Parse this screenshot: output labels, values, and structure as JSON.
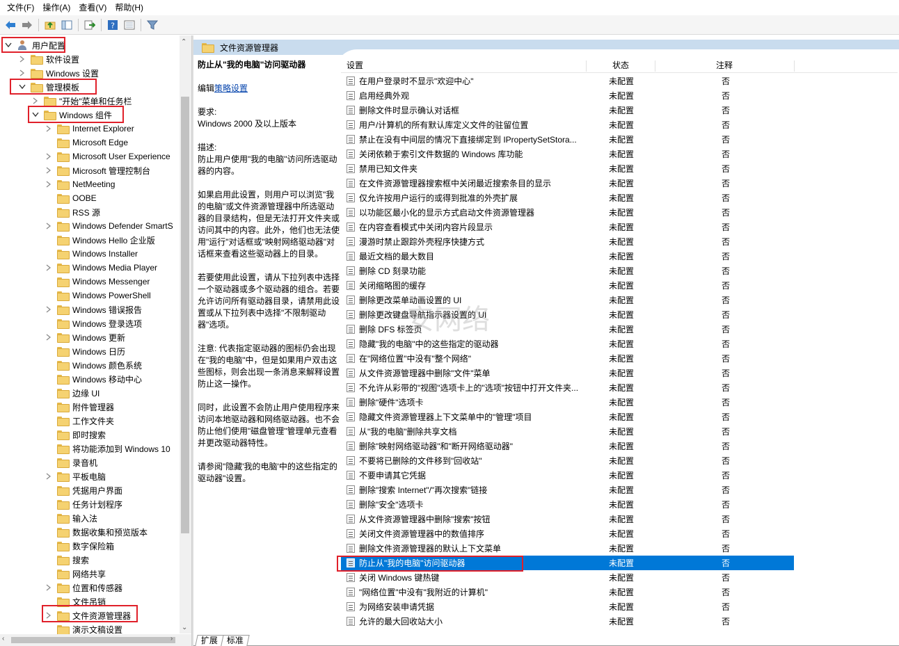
{
  "menu": [
    "文件(F)",
    "操作(A)",
    "查看(V)",
    "帮助(H)"
  ],
  "toolbar_icons": [
    "back-icon",
    "forward-icon",
    "up-folder-icon",
    "show-hide-tree-icon",
    "export-list-icon",
    "help-icon",
    "properties-icon",
    "filter-icon"
  ],
  "tree": {
    "items": [
      {
        "label": "用户配置",
        "level": 0,
        "expander": "expanded",
        "icon": "user-icon"
      },
      {
        "label": "软件设置",
        "level": 1,
        "expander": "collapsed",
        "icon": "folder-icon"
      },
      {
        "label": "Windows 设置",
        "level": 1,
        "expander": "collapsed",
        "icon": "folder-icon"
      },
      {
        "label": "管理模板",
        "level": 1,
        "expander": "expanded",
        "icon": "folder-icon"
      },
      {
        "label": "\"开始\"菜单和任务栏",
        "level": 2,
        "expander": "collapsed",
        "icon": "folder-icon"
      },
      {
        "label": "Windows 组件",
        "level": 2,
        "expander": "expanded",
        "icon": "folder-icon"
      },
      {
        "label": "Internet Explorer",
        "level": 3,
        "expander": "collapsed",
        "icon": "folder-icon"
      },
      {
        "label": "Microsoft Edge",
        "level": 3,
        "expander": "none",
        "icon": "folder-icon"
      },
      {
        "label": "Microsoft User Experience",
        "level": 3,
        "expander": "collapsed",
        "icon": "folder-icon"
      },
      {
        "label": "Microsoft 管理控制台",
        "level": 3,
        "expander": "collapsed",
        "icon": "folder-icon"
      },
      {
        "label": "NetMeeting",
        "level": 3,
        "expander": "collapsed",
        "icon": "folder-icon"
      },
      {
        "label": "OOBE",
        "level": 3,
        "expander": "none",
        "icon": "folder-icon"
      },
      {
        "label": "RSS 源",
        "level": 3,
        "expander": "none",
        "icon": "folder-icon"
      },
      {
        "label": "Windows Defender SmartS",
        "level": 3,
        "expander": "collapsed",
        "icon": "folder-icon"
      },
      {
        "label": "Windows Hello 企业版",
        "level": 3,
        "expander": "none",
        "icon": "folder-icon"
      },
      {
        "label": "Windows Installer",
        "level": 3,
        "expander": "none",
        "icon": "folder-icon"
      },
      {
        "label": "Windows Media Player",
        "level": 3,
        "expander": "collapsed",
        "icon": "folder-icon"
      },
      {
        "label": "Windows Messenger",
        "level": 3,
        "expander": "none",
        "icon": "folder-icon"
      },
      {
        "label": "Windows PowerShell",
        "level": 3,
        "expander": "none",
        "icon": "folder-icon"
      },
      {
        "label": "Windows 错误报告",
        "level": 3,
        "expander": "collapsed",
        "icon": "folder-icon"
      },
      {
        "label": "Windows 登录选项",
        "level": 3,
        "expander": "none",
        "icon": "folder-icon"
      },
      {
        "label": "Windows 更新",
        "level": 3,
        "expander": "collapsed",
        "icon": "folder-icon"
      },
      {
        "label": "Windows 日历",
        "level": 3,
        "expander": "none",
        "icon": "folder-icon"
      },
      {
        "label": "Windows 颜色系统",
        "level": 3,
        "expander": "none",
        "icon": "folder-icon"
      },
      {
        "label": "Windows 移动中心",
        "level": 3,
        "expander": "none",
        "icon": "folder-icon"
      },
      {
        "label": "边缘 UI",
        "level": 3,
        "expander": "none",
        "icon": "folder-icon"
      },
      {
        "label": "附件管理器",
        "level": 3,
        "expander": "none",
        "icon": "folder-icon"
      },
      {
        "label": "工作文件夹",
        "level": 3,
        "expander": "none",
        "icon": "folder-icon"
      },
      {
        "label": "即时搜索",
        "level": 3,
        "expander": "none",
        "icon": "folder-icon"
      },
      {
        "label": "将功能添加到 Windows 10",
        "level": 3,
        "expander": "none",
        "icon": "folder-icon"
      },
      {
        "label": "录音机",
        "level": 3,
        "expander": "none",
        "icon": "folder-icon"
      },
      {
        "label": "平板电脑",
        "level": 3,
        "expander": "collapsed",
        "icon": "folder-icon"
      },
      {
        "label": "凭据用户界面",
        "level": 3,
        "expander": "none",
        "icon": "folder-icon"
      },
      {
        "label": "任务计划程序",
        "level": 3,
        "expander": "none",
        "icon": "folder-icon"
      },
      {
        "label": "输入法",
        "level": 3,
        "expander": "none",
        "icon": "folder-icon"
      },
      {
        "label": "数据收集和预览版本",
        "level": 3,
        "expander": "none",
        "icon": "folder-icon"
      },
      {
        "label": "数字保险箱",
        "level": 3,
        "expander": "none",
        "icon": "folder-icon"
      },
      {
        "label": "搜索",
        "level": 3,
        "expander": "none",
        "icon": "folder-icon"
      },
      {
        "label": "网络共享",
        "level": 3,
        "expander": "none",
        "icon": "folder-icon"
      },
      {
        "label": "位置和传感器",
        "level": 3,
        "expander": "collapsed",
        "icon": "folder-icon"
      },
      {
        "label": "文件吊销",
        "level": 3,
        "expander": "none",
        "icon": "folder-icon"
      },
      {
        "label": "文件资源管理器",
        "level": 3,
        "expander": "collapsed",
        "icon": "folder-icon"
      },
      {
        "label": "演示文稿设置",
        "level": 3,
        "expander": "none",
        "icon": "folder-icon"
      }
    ]
  },
  "right": {
    "header_title": "文件资源管理器",
    "description": {
      "title": "防止从\"我的电脑\"访问驱动器",
      "edit_prefix": "编辑",
      "edit_link": "策略设置",
      "req_label": "要求:",
      "req_value": "Windows 2000 及以上版本",
      "desc_label": "描述:",
      "desc_text": "防止用户使用\"我的电脑\"访问所选驱动器的内容。",
      "para1": "如果启用此设置，则用户可以浏览\"我的电脑\"或文件资源管理器中所选驱动器的目录结构，但是无法打开文件夹或访问其中的内容。此外，他们也无法使用\"运行\"对话框或\"映射网络驱动器\"对话框来查看这些驱动器上的目录。",
      "para2": "若要使用此设置，请从下拉列表中选择一个驱动器或多个驱动器的组合。若要允许访问所有驱动器目录，请禁用此设置或从下拉列表中选择\"不限制驱动器\"选项。",
      "para3": "注意: 代表指定驱动器的图标仍会出现在\"我的电脑\"中，但是如果用户双击这些图标，则会出现一条消息来解释设置防止这一操作。",
      "para4": " 同时，此设置不会防止用户使用程序来访问本地驱动器和网络驱动器。也不会防止他们使用\"磁盘管理\"管理单元查看并更改驱动器特性。",
      "para5": "请参阅\"隐藏'我的电脑'中的这些指定的驱动器\"设置。"
    },
    "columns": {
      "setting": "设置",
      "state": "状态",
      "note": "注释"
    },
    "rows": [
      {
        "name": "在用户登录时不显示\"欢迎中心\"",
        "state": "未配置",
        "note": "否"
      },
      {
        "name": "启用经典外观",
        "state": "未配置",
        "note": "否"
      },
      {
        "name": "删除文件时显示确认对话框",
        "state": "未配置",
        "note": "否"
      },
      {
        "name": "用户/计算机的所有默认库定义文件的驻留位置",
        "state": "未配置",
        "note": "否"
      },
      {
        "name": "禁止在没有中间层的情况下直接绑定到 IPropertySetStora...",
        "state": "未配置",
        "note": "否"
      },
      {
        "name": "关闭依赖于索引文件数据的 Windows 库功能",
        "state": "未配置",
        "note": "否"
      },
      {
        "name": "禁用已知文件夹",
        "state": "未配置",
        "note": "否"
      },
      {
        "name": "在文件资源管理器搜索框中关闭最近搜索条目的显示",
        "state": "未配置",
        "note": "否"
      },
      {
        "name": "仅允许按用户运行的或得到批准的外壳扩展",
        "state": "未配置",
        "note": "否"
      },
      {
        "name": "以功能区最小化的显示方式启动文件资源管理器",
        "state": "未配置",
        "note": "否"
      },
      {
        "name": "在内容查看模式中关闭内容片段显示",
        "state": "未配置",
        "note": "否"
      },
      {
        "name": "漫游时禁止跟踪外壳程序快捷方式",
        "state": "未配置",
        "note": "否"
      },
      {
        "name": "最近文档的最大数目",
        "state": "未配置",
        "note": "否"
      },
      {
        "name": "删除 CD 刻录功能",
        "state": "未配置",
        "note": "否"
      },
      {
        "name": "关闭缩略图的缓存",
        "state": "未配置",
        "note": "否"
      },
      {
        "name": "删除更改菜单动画设置的 UI",
        "state": "未配置",
        "note": "否"
      },
      {
        "name": "删除更改键盘导航指示器设置的 UI",
        "state": "未配置",
        "note": "否"
      },
      {
        "name": "删除 DFS 标签页",
        "state": "未配置",
        "note": "否"
      },
      {
        "name": "隐藏\"我的电脑\"中的这些指定的驱动器",
        "state": "未配置",
        "note": "否"
      },
      {
        "name": "在\"网络位置\"中没有\"整个网络\"",
        "state": "未配置",
        "note": "否"
      },
      {
        "name": "从文件资源管理器中删除\"文件\"菜单",
        "state": "未配置",
        "note": "否"
      },
      {
        "name": "不允许从彩带的\"视图\"选项卡上的\"选项\"按钮中打开文件夹...",
        "state": "未配置",
        "note": "否"
      },
      {
        "name": "删除\"硬件\"选项卡",
        "state": "未配置",
        "note": "否"
      },
      {
        "name": "隐藏文件资源管理器上下文菜单中的\"管理\"项目",
        "state": "未配置",
        "note": "否"
      },
      {
        "name": "从\"我的电脑\"删除共享文档",
        "state": "未配置",
        "note": "否"
      },
      {
        "name": "删除\"映射网络驱动器\"和\"断开网络驱动器\"",
        "state": "未配置",
        "note": "否"
      },
      {
        "name": "不要将已删除的文件移到\"回收站\"",
        "state": "未配置",
        "note": "否"
      },
      {
        "name": "不要申请其它凭据",
        "state": "未配置",
        "note": "否"
      },
      {
        "name": "删除\"搜索 Internet\"/\"再次搜索\"链接",
        "state": "未配置",
        "note": "否"
      },
      {
        "name": "删除\"安全\"选项卡",
        "state": "未配置",
        "note": "否"
      },
      {
        "name": "从文件资源管理器中删除\"搜索\"按钮",
        "state": "未配置",
        "note": "否"
      },
      {
        "name": "关闭文件资源管理器中的数值排序",
        "state": "未配置",
        "note": "否"
      },
      {
        "name": "删除文件资源管理器的默认上下文菜单",
        "state": "未配置",
        "note": "否"
      },
      {
        "name": "防止从\"我的电脑\"访问驱动器",
        "state": "未配置",
        "note": "否",
        "selected": true
      },
      {
        "name": "关闭 Windows 键热键",
        "state": "未配置",
        "note": "否"
      },
      {
        "name": "\"网络位置\"中没有\"我附近的计算机\"",
        "state": "未配置",
        "note": "否"
      },
      {
        "name": "为网络安装申请凭据",
        "state": "未配置",
        "note": "否"
      },
      {
        "name": "允许的最大回收站大小",
        "state": "未配置",
        "note": "否"
      }
    ],
    "watermark": "安网络"
  },
  "tabs": [
    "扩展",
    "标准"
  ],
  "colors": {
    "selection": "#0078d7",
    "highlight_box": "#e0202a",
    "header_band": "#c9dcee"
  }
}
